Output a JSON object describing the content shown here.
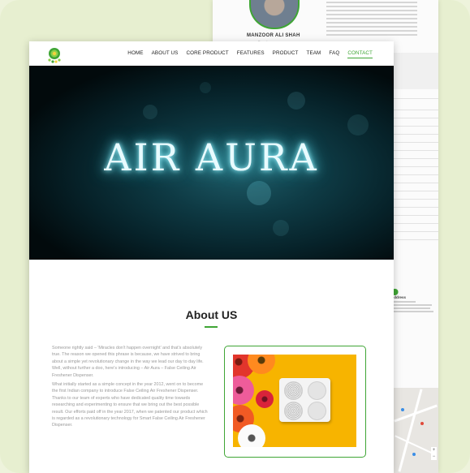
{
  "back_page": {
    "member_name": "MANZOOR ALI SHAH",
    "member_role": "Founder",
    "address_heading": "Address"
  },
  "nav": {
    "items": [
      {
        "label": "HOME"
      },
      {
        "label": "ABOUT US"
      },
      {
        "label": "CORE PRODUCT"
      },
      {
        "label": "FEATURES"
      },
      {
        "label": "PRODUCT"
      },
      {
        "label": "TEAM"
      },
      {
        "label": "FAQ"
      },
      {
        "label": "CONTACT",
        "active": true
      }
    ]
  },
  "hero": {
    "title": "AIR AURA"
  },
  "about": {
    "heading": "About US",
    "paragraphs": [
      "Someone rightly said – 'Miracles don't happen overnight' and that's absolutely true. The reason we opened this phrase is because, we have strived to bring about a simple yet revolutionary change in the way we lead our day to day life. Well, without further a doo, here's introducing – Air Aura – False Ceiling Air Freshener Dispenser.",
      "What initially started as a simple concept in the year 2012, went on to become the first Indian company to introduce False Ceiling Air Freshener Dispenser. Thanks to our team of experts who have dedicated quality time towards researching and experimenting to ensure that we bring out the best possible result. Our efforts paid off in the year 2017, when we patented our product which is regarded as a revolutionary technology for Smart False Ceiling Air Freshener Dispenser."
    ]
  },
  "colors": {
    "accent": "#3fa535",
    "hero_text": "#e8fbff",
    "image_bg": "#f7b400"
  }
}
